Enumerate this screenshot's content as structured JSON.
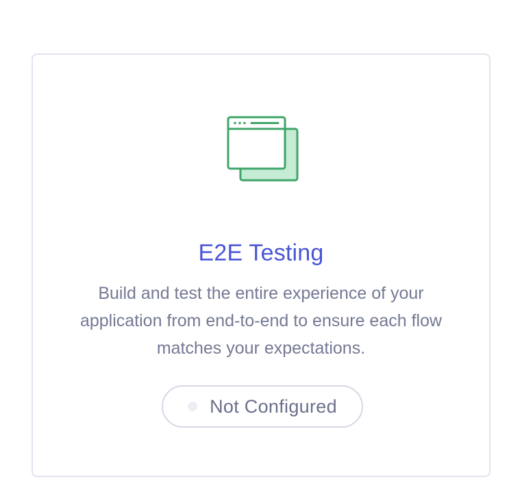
{
  "card": {
    "icon": "browser-windows-icon",
    "title": "E2E Testing",
    "description": "Build and test the entire experience of your application from end-to-end to ensure each flow matches your expectations.",
    "status": {
      "label": "Not Configured",
      "dot_icon": "status-dot-icon"
    }
  },
  "colors": {
    "title": "#4955d6",
    "description": "#747994",
    "icon_stroke": "#3fa569",
    "icon_fill_back": "#c6ecd6",
    "border": "#e2e3ee",
    "status_dot": "#ecedf5"
  }
}
